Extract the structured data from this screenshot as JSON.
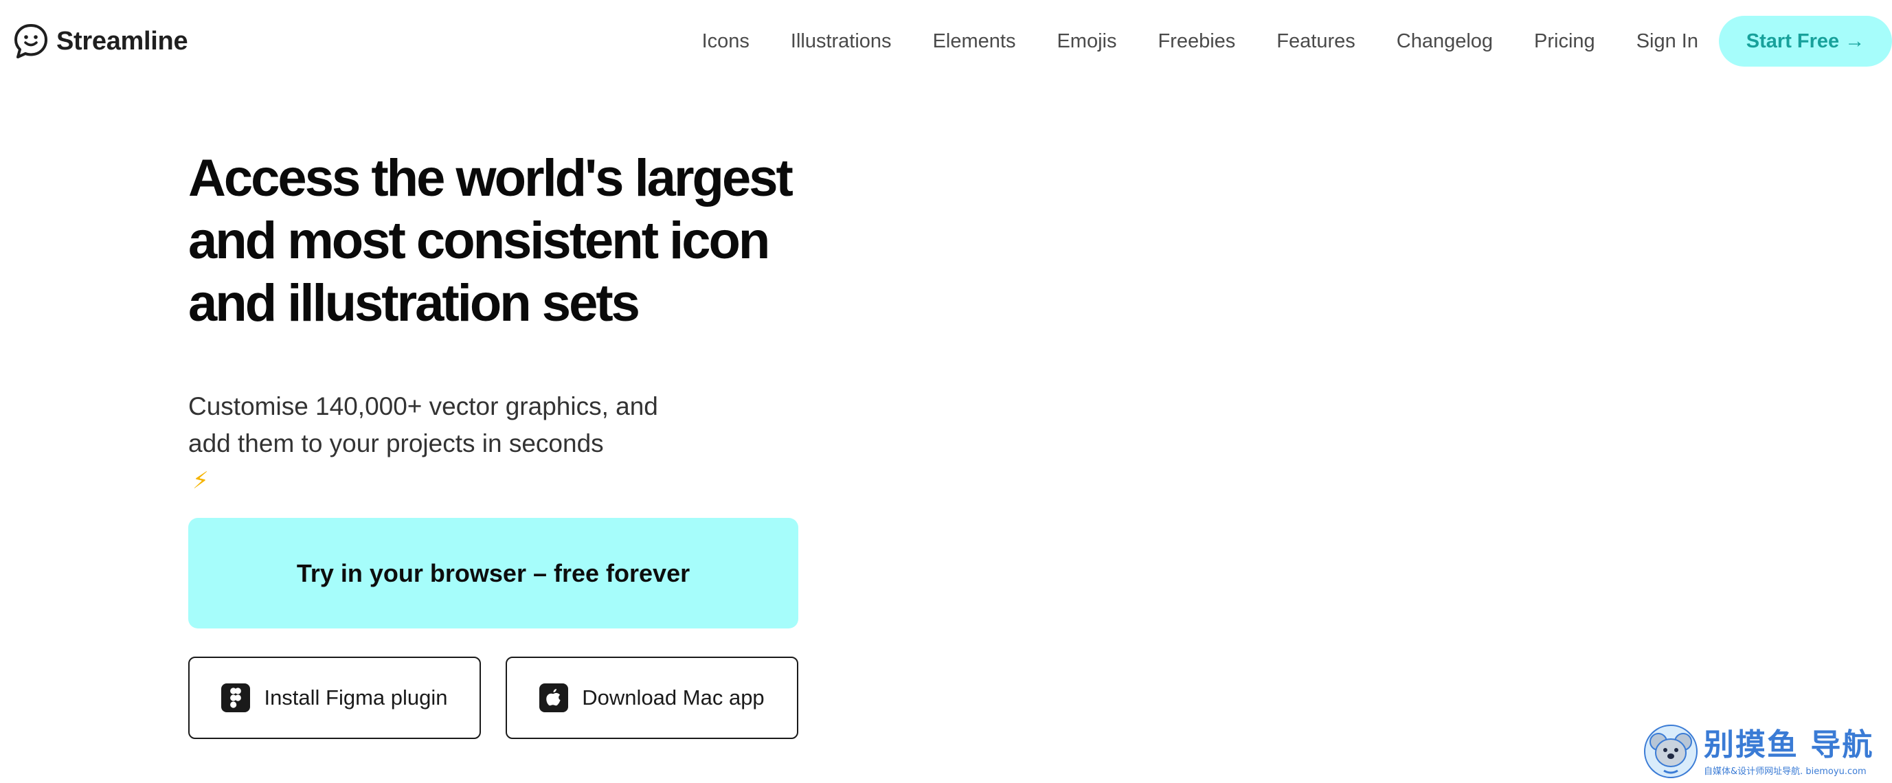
{
  "header": {
    "brand_name": "Streamline",
    "brand_icon": "chat-bubble-face-icon",
    "nav": [
      {
        "label": "Icons"
      },
      {
        "label": "Illustrations"
      },
      {
        "label": "Elements"
      },
      {
        "label": "Emojis"
      },
      {
        "label": "Freebies"
      },
      {
        "label": "Features"
      },
      {
        "label": "Changelog"
      },
      {
        "label": "Pricing"
      },
      {
        "label": "Sign In"
      }
    ],
    "start_free_label": "Start Free",
    "start_free_arrow": "→"
  },
  "hero": {
    "title_lines": [
      "Access the world's largest",
      "and most consistent icon",
      "and illustration sets"
    ],
    "subtitle_lines": [
      "Customise 140,000+ vector graphics, and",
      "add them to your projects in seconds"
    ],
    "subtitle_emoji": "⚡",
    "primary_cta": "Try in your browser – free forever",
    "figma_cta": "Install Figma plugin",
    "mac_cta": "Download Mac app"
  },
  "watermark": {
    "main": "别摸鱼 导航",
    "sub": "自媒体&设计师网址导航. biemoyu.com"
  },
  "colors": {
    "accent_bg": "#a6fdfb",
    "accent_text": "#17a19b",
    "text_dark": "#0a0a0a",
    "nav_text": "#4a4a4a",
    "bolt": "#f5b400",
    "watermark": "#3a7bd5"
  }
}
